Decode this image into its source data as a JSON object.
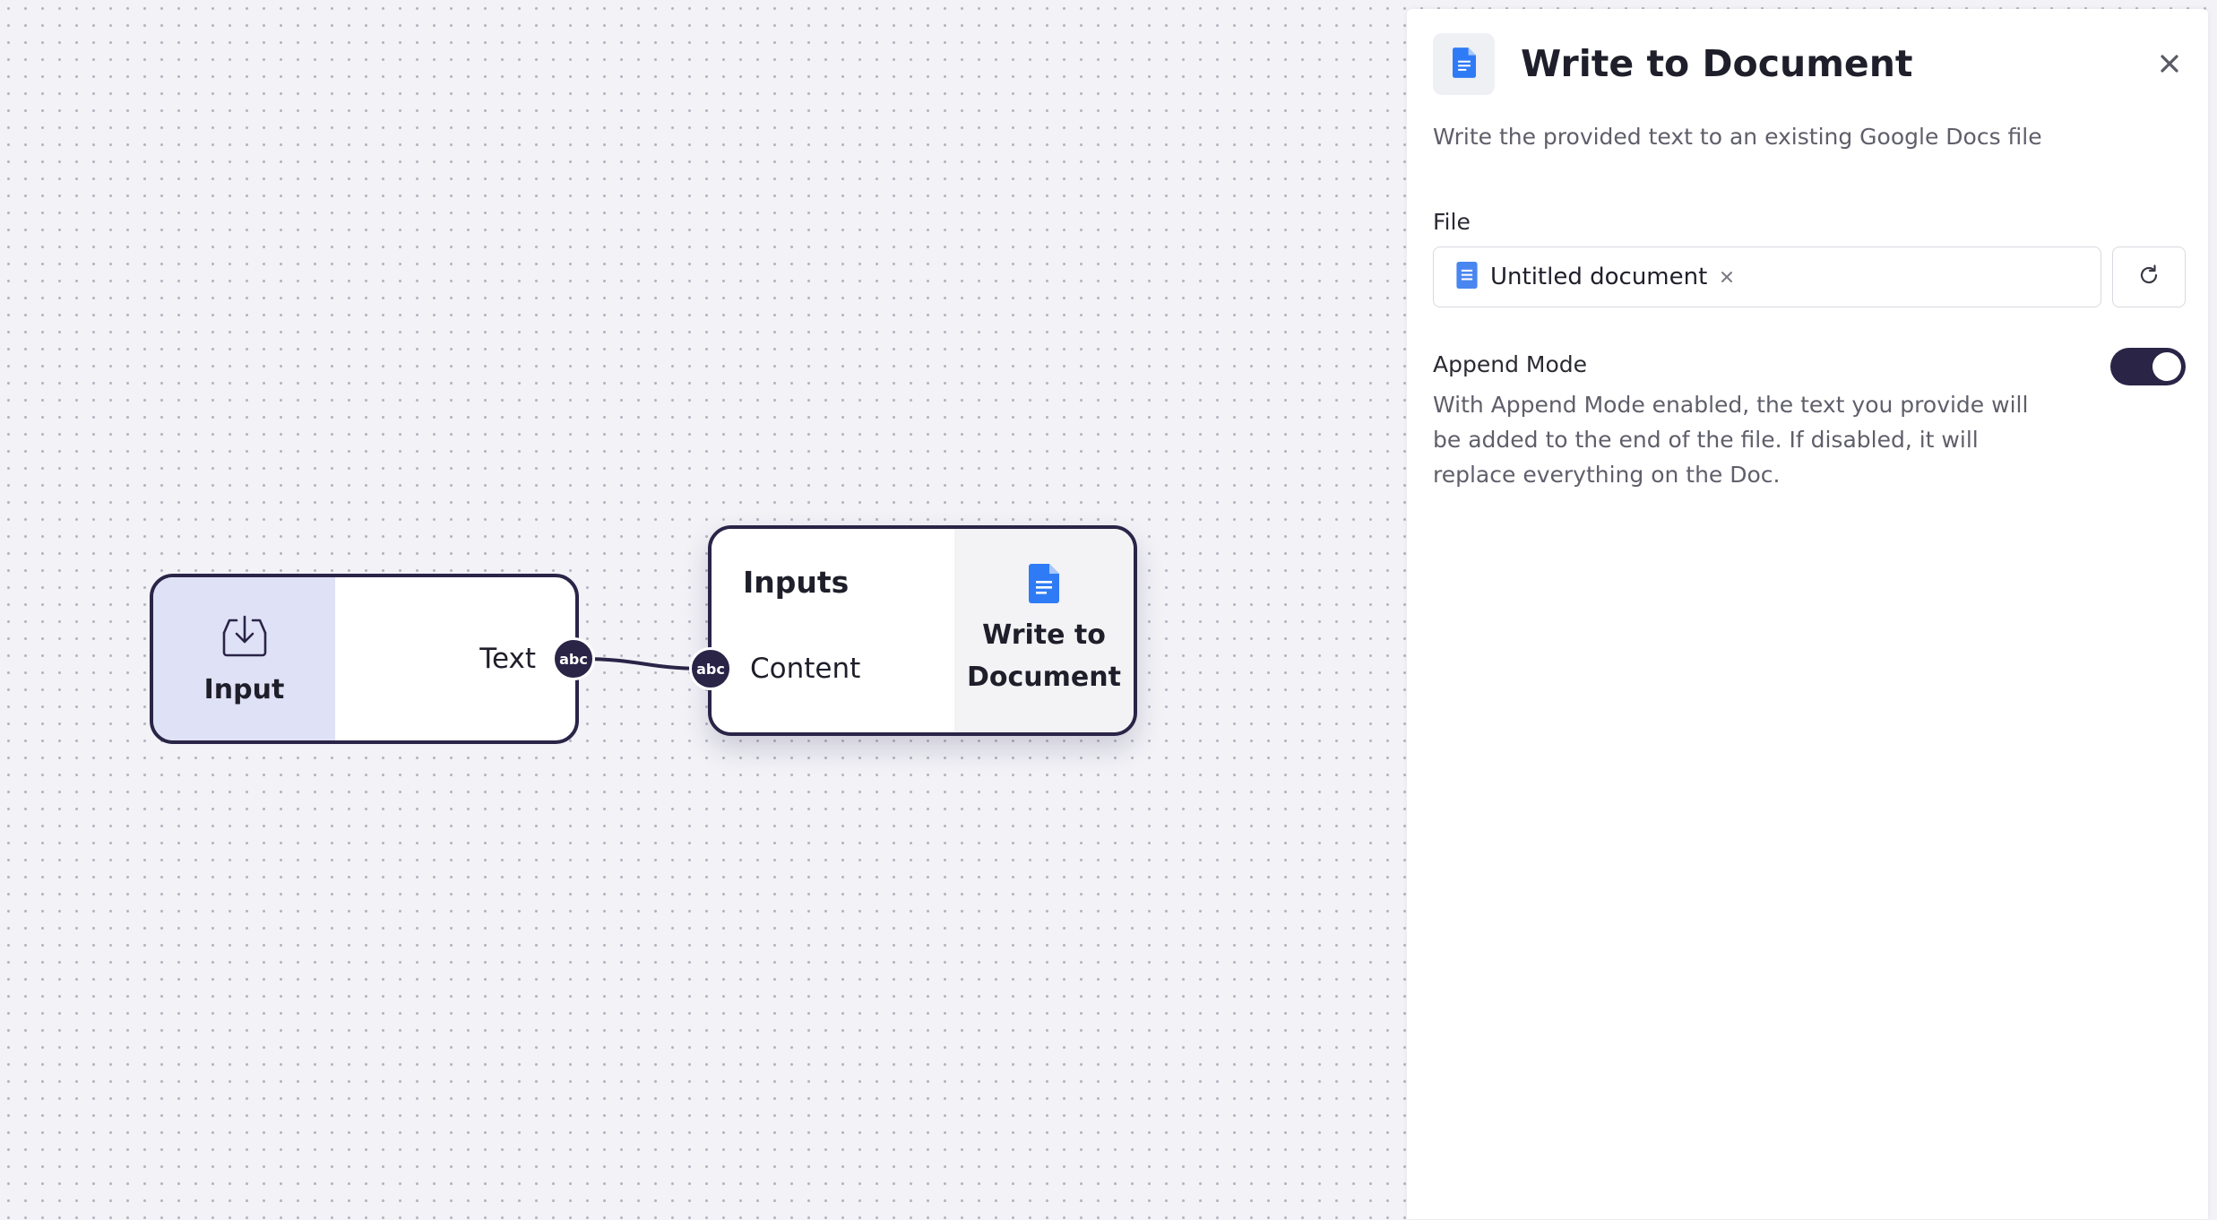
{
  "canvas": {
    "input_node": {
      "title": "Input",
      "icon": "inbox-download-icon",
      "output_port": {
        "label": "Text",
        "type_badge": "abc"
      }
    },
    "write_node": {
      "section_title": "Inputs",
      "input_port": {
        "label": "Content",
        "type_badge": "abc"
      },
      "title_line1": "Write to",
      "title_line2": "Document",
      "icon": "google-docs-icon"
    }
  },
  "panel": {
    "icon": "google-docs-icon",
    "title": "Write to Document",
    "description": "Write the provided text to an existing Google Docs file",
    "file": {
      "label": "File",
      "value": "Untitled document",
      "value_icon": "google-docs-icon"
    },
    "append_mode": {
      "label": "Append Mode",
      "enabled": true,
      "help": "With Append Mode enabled, the text you provide will be added to the end of the file. If disabled, it will replace everything on the Doc."
    }
  },
  "colors": {
    "node_border": "#2a2447",
    "input_node_accent": "#dfe2f6",
    "docs_blue": "#2f7bf5",
    "toggle_on": "#2a2447"
  }
}
